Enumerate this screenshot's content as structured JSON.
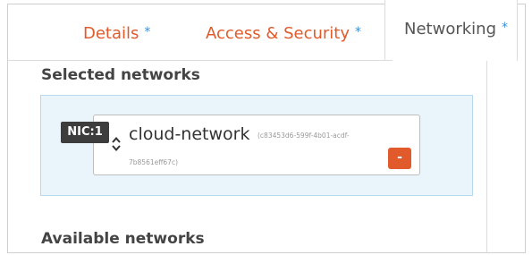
{
  "tabs": [
    {
      "label": "Details",
      "required": "*"
    },
    {
      "label": "Access & Security",
      "required": "*"
    },
    {
      "label": "Networking",
      "required": "*",
      "active": true
    }
  ],
  "selected_networks": {
    "title": "Selected networks",
    "nic": {
      "badge": "NIC:1",
      "name": "cloud-network",
      "id_line1": "(c83453d6-599f-4b01-acdf-",
      "id_line2": "7b8561eff67c)",
      "remove_label": "-"
    }
  },
  "available_networks": {
    "title": "Available networks"
  },
  "colors": {
    "accent": "#e05a2b",
    "required_marker": "#3a8fd6",
    "dropzone_bg": "#e9f4fb",
    "badge_bg": "#3d3d3d"
  }
}
